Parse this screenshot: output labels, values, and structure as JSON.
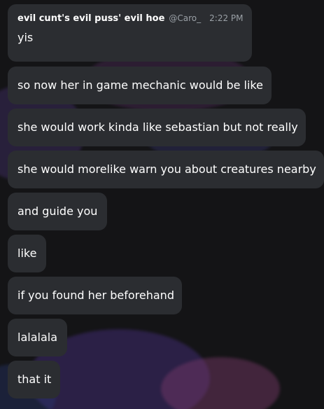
{
  "header": {
    "username": "evil cunt's evil puss' evil hoe",
    "handle": "@Caro_",
    "timestamp": "2:22 PM"
  },
  "messages": [
    "yis",
    "so now her in game mechanic would be like",
    "she would work kinda like sebastian but not really",
    "she would morelike warn you about creatures nearby",
    "and guide you",
    "like",
    "if you found her beforehand",
    "lalalala",
    "that it"
  ],
  "colors": {
    "background": "#141416",
    "bubble": "#2b2d31",
    "text": "#ffffff",
    "muted": "#9aa0a6"
  }
}
